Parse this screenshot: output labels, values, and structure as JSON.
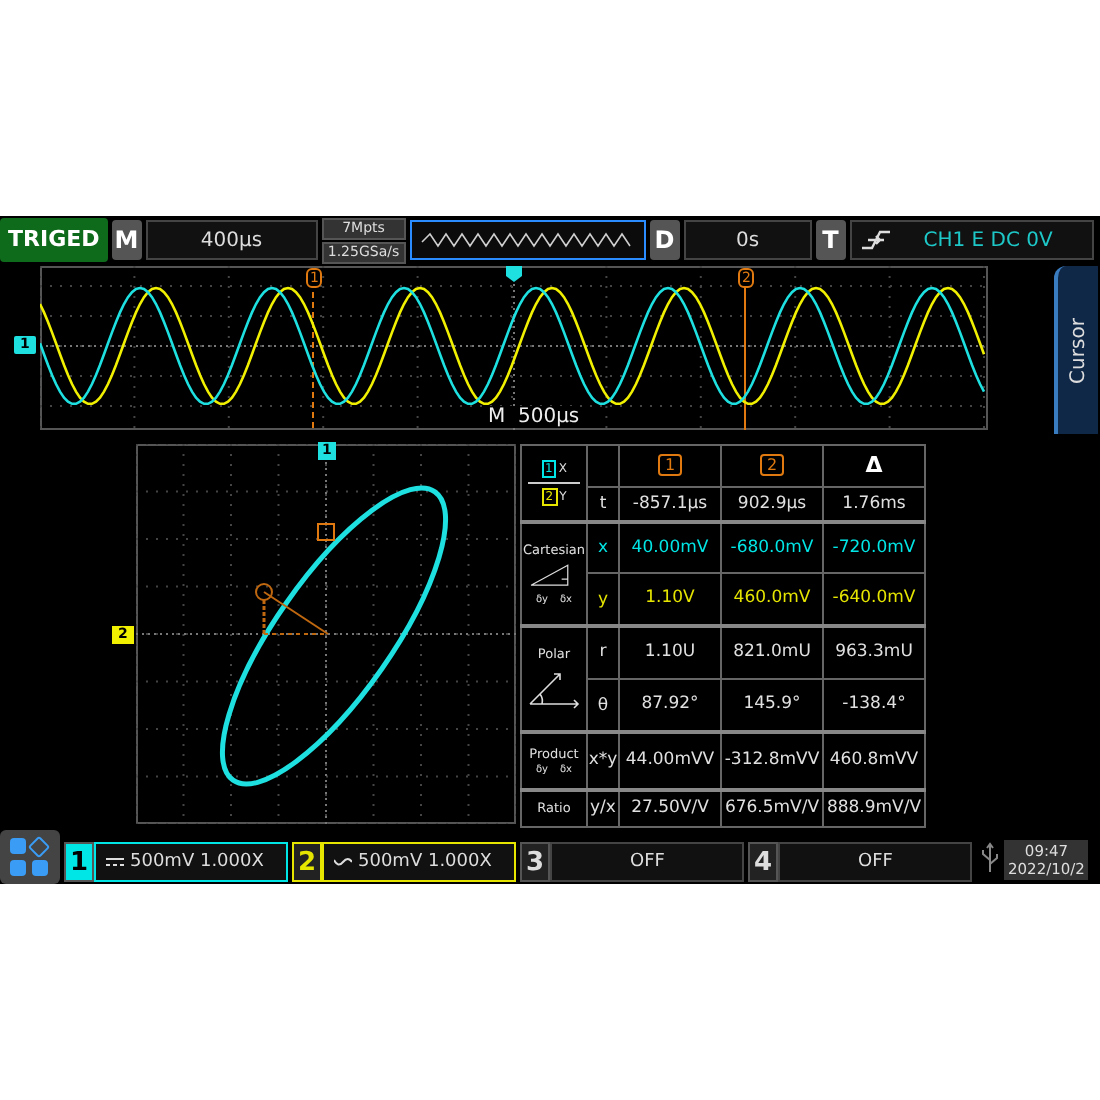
{
  "top_bar": {
    "trigger_status": "TRIGED",
    "horizontal": {
      "label": "M",
      "value": "400µs"
    },
    "memory_depth": "7Mpts",
    "sample_rate": "1.25GSa/s",
    "delay": {
      "label": "D",
      "value": "0s"
    },
    "trigger": {
      "label": "T",
      "value": "CH1 E DC 0V"
    }
  },
  "waveform": {
    "channel_marker": "1",
    "cursor_markers": [
      "1",
      "2"
    ],
    "timebase_label": "M",
    "timebase": "500µs"
  },
  "side_tab": "Cursor",
  "xy_plot": {
    "x_marker": "1",
    "y_marker": "2"
  },
  "cursor_table": {
    "legend": [
      {
        "source": "1",
        "axis": "X",
        "color": "#00e5e5"
      },
      {
        "source": "2",
        "axis": "Y",
        "color": "#e5e500"
      }
    ],
    "columns": [
      {
        "label": "1",
        "kind": "boxed"
      },
      {
        "label": "2",
        "kind": "boxed"
      },
      {
        "label": "Δ",
        "kind": "plain"
      }
    ],
    "t_row": {
      "symbol": "t",
      "values": [
        "-857.1µs",
        "902.9µs",
        "1.76ms"
      ]
    },
    "groups": [
      {
        "label": "Cartesian",
        "kind": "cartesian",
        "icon_labels": [
          "δy",
          "δx"
        ],
        "rows": [
          {
            "symbol": "x",
            "color": "#00e5e5",
            "values": [
              "40.00mV",
              "-680.0mV",
              "-720.0mV"
            ]
          },
          {
            "symbol": "y",
            "color": "#e5e500",
            "values": [
              "1.10V",
              "460.0mV",
              "-640.0mV"
            ]
          }
        ]
      },
      {
        "label": "Polar",
        "kind": "polar",
        "rows": [
          {
            "symbol": "r",
            "color": "#e0e0e0",
            "values": [
              "1.10U",
              "821.0mU",
              "963.3mU"
            ]
          },
          {
            "symbol": "θ",
            "color": "#e0e0e0",
            "values": [
              "87.92°",
              "145.9°",
              "-138.4°"
            ]
          }
        ]
      },
      {
        "label": "Product",
        "kind": "product",
        "icon_labels": [
          "δy",
          "δx"
        ],
        "rows": [
          {
            "symbol": "x*y",
            "color": "#e0e0e0",
            "values": [
              "44.00mVV",
              "-312.8mVV",
              "460.8mVV"
            ]
          }
        ]
      },
      {
        "label": "Ratio",
        "kind": "none",
        "rows": [
          {
            "symbol": "y/x",
            "color": "#e0e0e0",
            "values": [
              "27.50V/V",
              "676.5mV/V",
              "888.9mV/V"
            ]
          }
        ]
      }
    ]
  },
  "channels": [
    {
      "number": "1",
      "kind": "dc",
      "scale": "500mV",
      "probe": "1.000X",
      "color": "#00e5e5",
      "selected": true,
      "enabled": true
    },
    {
      "number": "2",
      "kind": "ac",
      "scale": "500mV",
      "probe": "1.000X",
      "color": "#e5e500",
      "selected": false,
      "enabled": true
    },
    {
      "number": "3",
      "status": "OFF",
      "selected": false,
      "enabled": false
    },
    {
      "number": "4",
      "status": "OFF",
      "selected": false,
      "enabled": false
    }
  ],
  "clock": {
    "time": "09:47",
    "date": "2022/10/2"
  }
}
